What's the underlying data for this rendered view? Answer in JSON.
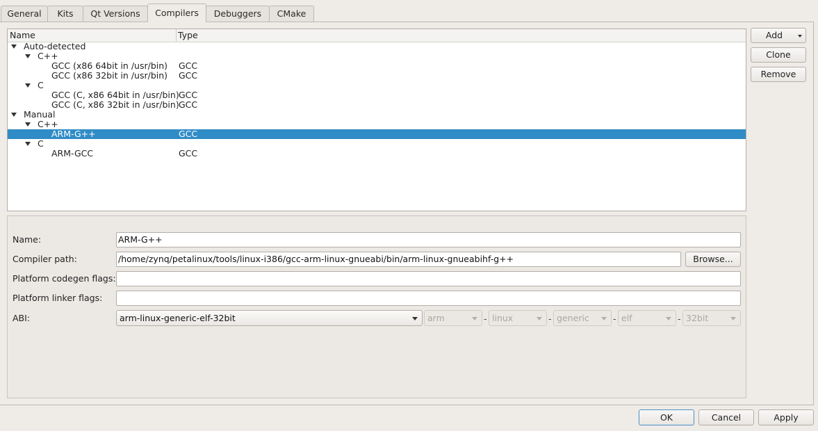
{
  "tabs": [
    "General",
    "Kits",
    "Qt Versions",
    "Compilers",
    "Debuggers",
    "CMake"
  ],
  "active_tab": "Compilers",
  "tree": {
    "headers": [
      "Name",
      "Type"
    ],
    "rows": [
      {
        "label": "Auto-detected",
        "type": ""
      },
      {
        "label": "C++",
        "type": ""
      },
      {
        "label": "GCC (x86 64bit in /usr/bin)",
        "type": "GCC"
      },
      {
        "label": "GCC (x86 32bit in /usr/bin)",
        "type": "GCC"
      },
      {
        "label": "C",
        "type": ""
      },
      {
        "label": "GCC (C, x86 64bit in /usr/bin)",
        "type": "GCC"
      },
      {
        "label": "GCC (C, x86 32bit in /usr/bin)",
        "type": "GCC"
      },
      {
        "label": "Manual",
        "type": ""
      },
      {
        "label": "C++",
        "type": ""
      },
      {
        "label": "ARM-G++",
        "type": "GCC"
      },
      {
        "label": "C",
        "type": ""
      },
      {
        "label": "ARM-GCC",
        "type": "GCC"
      }
    ],
    "selected_row": "ARM-G++"
  },
  "side_buttons": {
    "add": "Add",
    "clone": "Clone",
    "remove": "Remove"
  },
  "details": {
    "name_label": "Name:",
    "name_value": "ARM-G++",
    "path_label": "Compiler path:",
    "path_value": "/home/zynq/petalinux/tools/linux-i386/gcc-arm-linux-gnueabi/bin/arm-linux-gnueabihf-g++",
    "browse": "Browse...",
    "codegen_label": "Platform codegen flags:",
    "codegen_value": "",
    "linker_label": "Platform linker flags:",
    "linker_value": "",
    "abi_label": "ABI:",
    "abi_value": "arm-linux-generic-elf-32bit",
    "abi_parts": [
      "arm",
      "linux",
      "generic",
      "elf",
      "32bit"
    ],
    "abi_sep": "-"
  },
  "footer": {
    "ok": "OK",
    "cancel": "Cancel",
    "apply": "Apply"
  },
  "colors": {
    "selection": "#308cc6",
    "window": "#efebe7"
  }
}
